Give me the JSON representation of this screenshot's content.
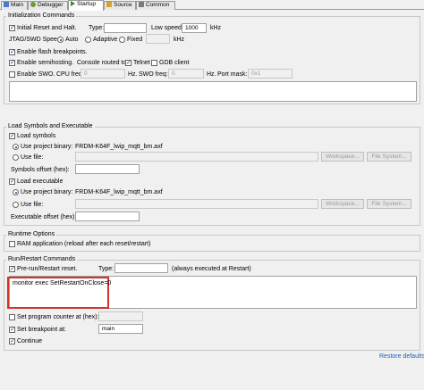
{
  "tabs": [
    {
      "label": "Main"
    },
    {
      "label": "Debugger"
    },
    {
      "label": "Startup"
    },
    {
      "label": "Source"
    },
    {
      "label": "Common"
    }
  ],
  "init": {
    "title": "Initialization Commands",
    "initial_reset": "Initial Reset and Halt.",
    "type_label": "Type:",
    "type_value": "",
    "low_speed_label": "Low speed:",
    "low_speed_value": "1000",
    "low_speed_unit": "kHz",
    "jtag_label": "JTAG/SWD Speed:",
    "auto": "Auto",
    "adaptive": "Adaptive",
    "fixed": "Fixed",
    "fixed_unit": "kHz",
    "flash_bp": "Enable flash breakpoints.",
    "semihosting": "Enable semihosting.",
    "console_routed": "Console routed to:",
    "telnet": "Telnet",
    "gdb_client": "GDB client",
    "swo": "Enable SWO.",
    "cpu_freq_label": "CPU freq:",
    "cpu_freq_value": "0",
    "hz1": "Hz.",
    "swo_freq_label": "SWO freq:",
    "swo_freq_value": "0",
    "hz2": "Hz.",
    "port_mask_label": "Port mask:",
    "port_mask_value": "0x1"
  },
  "load": {
    "title": "Load Symbols and Executable",
    "load_symbols": "Load symbols",
    "use_project_binary": "Use project binary:",
    "sym_binary": "FRDM-K64F_lwip_mqtt_bm.axf",
    "use_file": "Use file:",
    "workspace": "Workspace...",
    "file_system": "File System...",
    "sym_offset_label": "Symbols offset (hex):",
    "load_executable": "Load executable",
    "use_project_binary2": "Use project binary:",
    "exe_binary": "FRDM-K64F_lwip_mqtt_bm.axf",
    "use_file2": "Use file:",
    "workspace2": "Workspace...",
    "file_system2": "File System...",
    "exe_offset_label": "Executable offset (hex):"
  },
  "runtime": {
    "title": "Runtime Options",
    "ram_app": "RAM application (reload after each reset/restart)"
  },
  "run": {
    "title": "Run/Restart Commands",
    "pre_run": "Pre-run/Restart reset.",
    "type_label": "Type:",
    "always": "(always executed at Restart)",
    "commands": "monitor exec SetRestartOnClose=0",
    "set_pc": "Set program counter at (hex):",
    "set_bp": "Set breakpoint at:",
    "bp_value": "main",
    "continue": "Continue"
  },
  "restore_defaults": "Restore defaults"
}
